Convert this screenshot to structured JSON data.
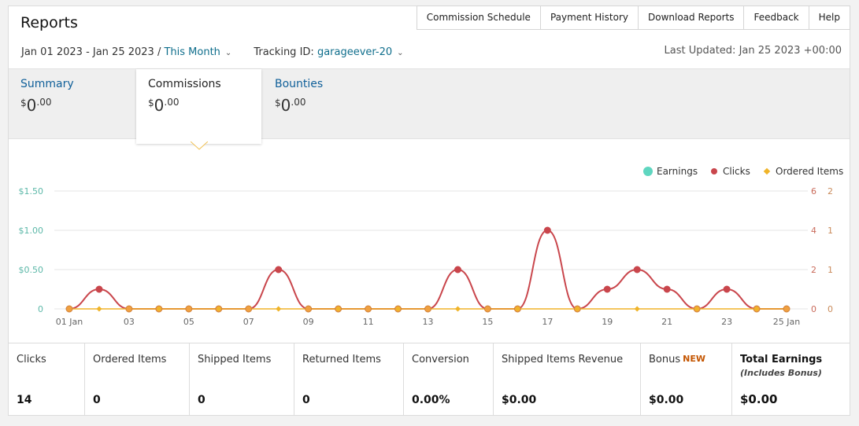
{
  "header": {
    "title": "Reports",
    "nav": [
      "Commission Schedule",
      "Payment History",
      "Download Reports",
      "Feedback",
      "Help"
    ]
  },
  "filters": {
    "date_range": "Jan 01 2023 - Jan 25 2023 /",
    "period": "This Month",
    "tracking_label": "Tracking ID:",
    "tracking_id": "garageever-20",
    "last_updated": "Last Updated: Jan 25 2023 +00:00"
  },
  "tabs": [
    {
      "label": "Summary",
      "currency": "$",
      "whole": "0",
      "cents": ".00",
      "active": false
    },
    {
      "label": "Commissions",
      "currency": "$",
      "whole": "0",
      "cents": ".00",
      "active": true
    },
    {
      "label": "Bounties",
      "currency": "$",
      "whole": "0",
      "cents": ".00",
      "active": false
    }
  ],
  "chart_data": {
    "type": "line",
    "legend": [
      "Earnings",
      "Clicks",
      "Ordered Items"
    ],
    "legend_position": "top-right",
    "colors": {
      "Earnings": "#5fd6c0",
      "Clicks": "#c9464c",
      "Ordered Items": "#f0b429",
      "Clicks_marker_fill": "#f0a040"
    },
    "x_tick_labels": [
      "01 Jan",
      "03",
      "05",
      "07",
      "09",
      "11",
      "13",
      "15",
      "17",
      "19",
      "21",
      "23",
      "25 Jan"
    ],
    "left_axis_ticks": [
      "$1.50",
      "$1.00",
      "$0.50",
      "0"
    ],
    "right_axis_ticks_a": [
      "6",
      "4",
      "2",
      "0"
    ],
    "right_axis_ticks_b": [
      "2",
      "1",
      "1",
      "0"
    ],
    "x": [
      1,
      2,
      3,
      4,
      5,
      6,
      7,
      8,
      9,
      10,
      11,
      12,
      13,
      14,
      15,
      16,
      17,
      18,
      19,
      20,
      21,
      22,
      23,
      24,
      25
    ],
    "series": [
      {
        "name": "Earnings",
        "values": [
          0,
          0,
          0,
          0,
          0,
          0,
          0,
          0,
          0,
          0,
          0,
          0,
          0,
          0,
          0,
          0,
          0,
          0,
          0,
          0,
          0,
          0,
          0,
          0,
          0
        ]
      },
      {
        "name": "Clicks",
        "values": [
          0,
          1,
          0,
          0,
          0,
          0,
          0,
          2,
          0,
          0,
          0,
          0,
          0,
          2,
          0,
          0,
          4,
          0,
          1,
          2,
          1,
          0,
          1,
          0,
          0
        ]
      },
      {
        "name": "Ordered Items",
        "values": [
          0,
          0,
          0,
          0,
          0,
          0,
          0,
          0,
          0,
          0,
          0,
          0,
          0,
          0,
          0,
          0,
          0,
          0,
          0,
          0,
          0,
          0,
          0,
          0,
          0
        ]
      }
    ],
    "ylim_left": [
      0,
      1.5
    ],
    "ylim_clicks": [
      0,
      6
    ],
    "grid": true
  },
  "stats": [
    {
      "label": "Clicks",
      "value": "14"
    },
    {
      "label": "Ordered Items",
      "value": "0"
    },
    {
      "label": "Shipped Items",
      "value": "0"
    },
    {
      "label": "Returned Items",
      "value": "0"
    },
    {
      "label": "Conversion",
      "value": "0.00%"
    },
    {
      "label": "Shipped Items Revenue",
      "value": "$0.00"
    },
    {
      "label": "Bonus",
      "badge": "NEW",
      "value": "$0.00"
    },
    {
      "label": "Total Earnings",
      "sublabel": "(Includes Bonus)",
      "value": "$0.00"
    }
  ]
}
